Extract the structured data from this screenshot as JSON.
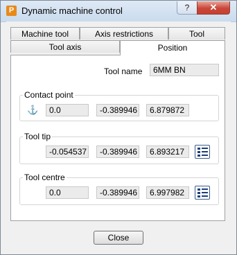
{
  "window": {
    "title": "Dynamic machine control",
    "help_label": "?",
    "close_glyph": "✕",
    "app_icon_letter": "P"
  },
  "tabs": {
    "row1": [
      "Machine tool",
      "Axis restrictions",
      "Tool"
    ],
    "row2": [
      "Tool axis",
      "Position"
    ],
    "active": "Position"
  },
  "tool": {
    "name_label": "Tool name",
    "name_value": "6MM BN"
  },
  "contact_point": {
    "title": "Contact point",
    "icon": "anchor-icon",
    "x": "0.0",
    "y": "-0.389946",
    "z": "6.879872"
  },
  "tool_tip": {
    "title": "Tool tip",
    "icon": "list-icon",
    "x": "-0.054537",
    "y": "-0.389946",
    "z": "6.893217"
  },
  "tool_centre": {
    "title": "Tool centre",
    "icon": "list-icon",
    "x": "0.0",
    "y": "-0.389946",
    "z": "6.997982"
  },
  "footer": {
    "close_label": "Close"
  },
  "colors": {
    "accent": "#e88a1a",
    "close_red": "#c9463a",
    "field_bg": "#ebebeb"
  }
}
